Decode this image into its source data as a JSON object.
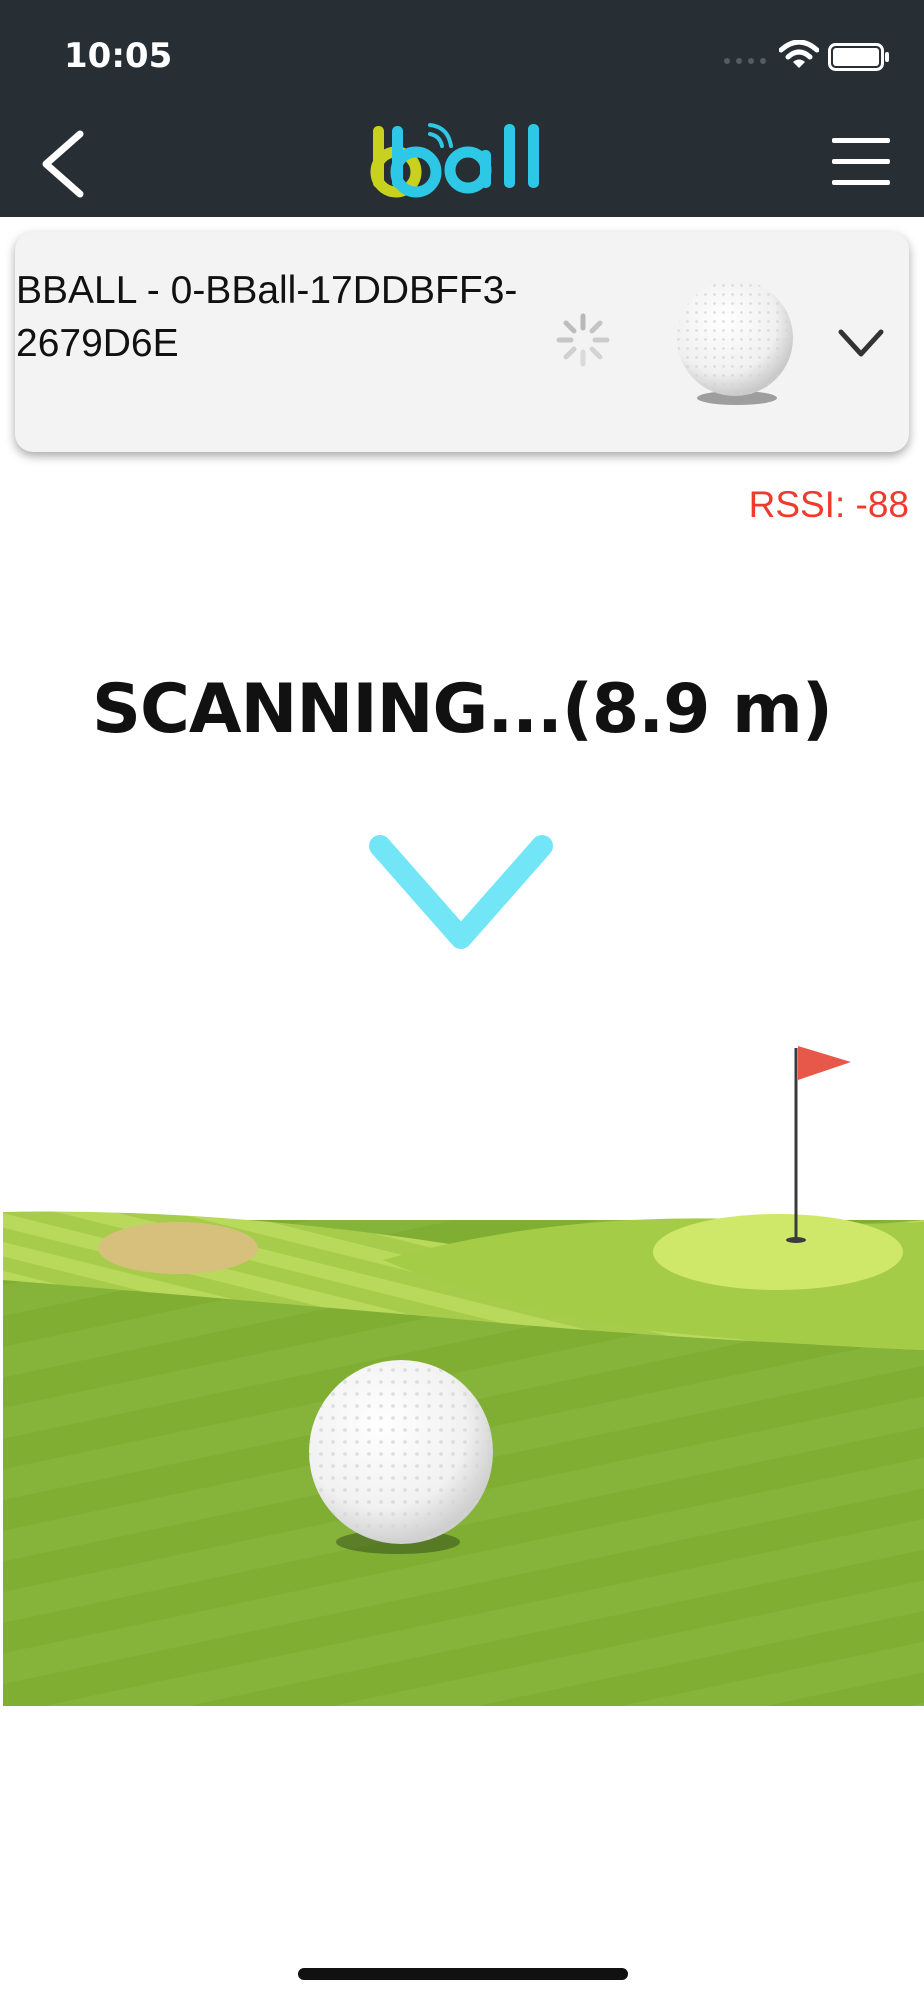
{
  "status_bar": {
    "time": "10:05"
  },
  "header": {
    "logo_text": "bball"
  },
  "device": {
    "name": "BBALL - 0-BBall-17DDBFF3-2679D6E"
  },
  "rssi": "RSSI: -88",
  "scanning_text": "SCANNING...(8.9 m)",
  "colors": {
    "header_bg": "#272f34",
    "logo_yellow": "#c8d21e",
    "logo_cyan": "#2cc8e6",
    "rssi_red": "#f03a2e",
    "arrow_cyan": "#72e6f7",
    "grass_green": "#86b43a",
    "flag_red": "#e8584a"
  }
}
